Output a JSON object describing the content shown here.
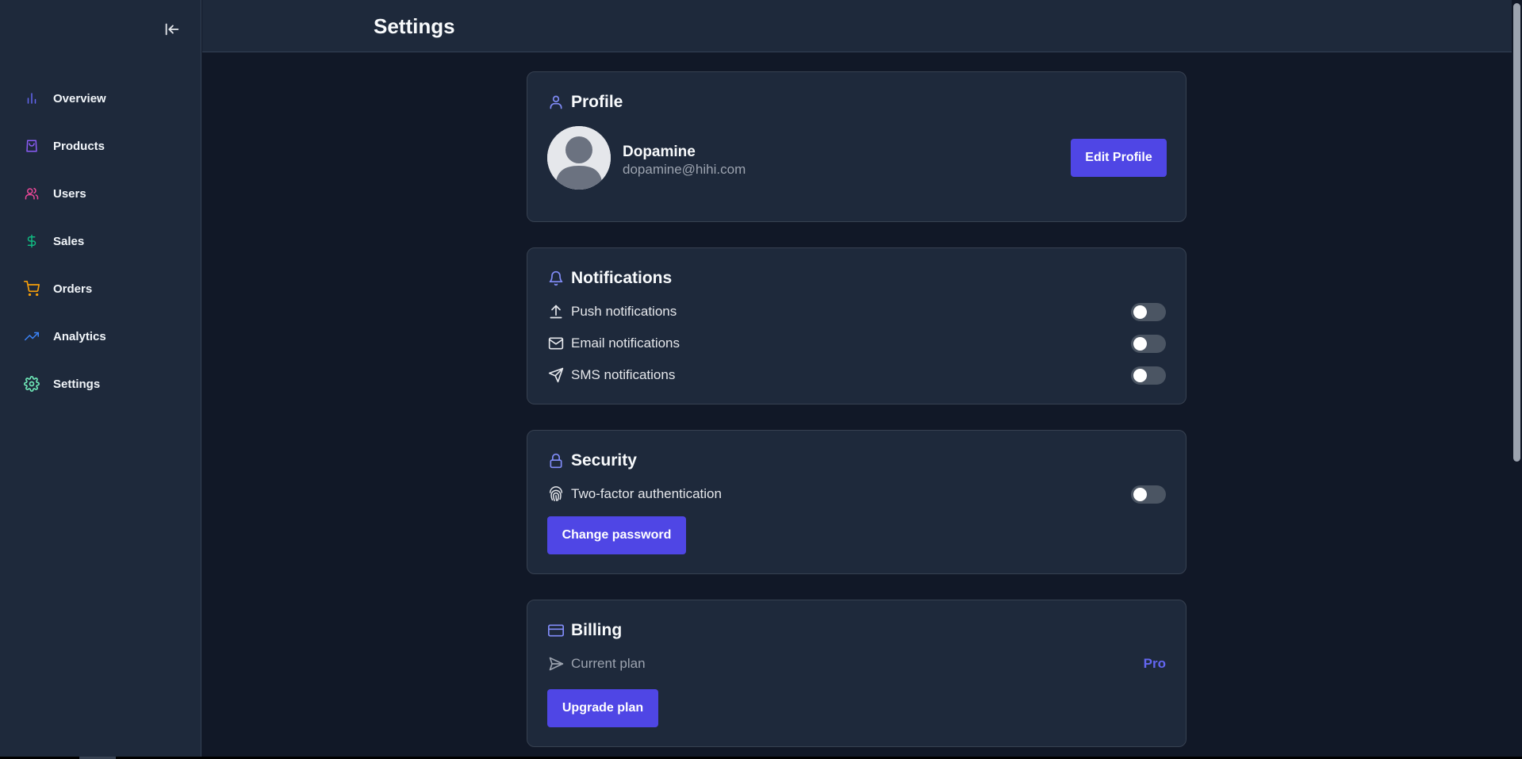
{
  "header": {
    "title": "Settings"
  },
  "sidebar": {
    "items": [
      {
        "label": "Overview",
        "icon": "bar-chart-icon",
        "color": "#6366f1"
      },
      {
        "label": "Products",
        "icon": "shopping-bag-icon",
        "color": "#8b5cf6"
      },
      {
        "label": "Users",
        "icon": "users-icon",
        "color": "#ec4899"
      },
      {
        "label": "Sales",
        "icon": "dollar-icon",
        "color": "#10b981"
      },
      {
        "label": "Orders",
        "icon": "shopping-cart-icon",
        "color": "#f59e0b"
      },
      {
        "label": "Analytics",
        "icon": "trending-up-icon",
        "color": "#3b82f6"
      },
      {
        "label": "Settings",
        "icon": "settings-icon",
        "color": "#6ee7b7"
      }
    ]
  },
  "profile": {
    "title": "Profile",
    "name": "Dopamine",
    "email": "dopamine@hihi.com",
    "edit_label": "Edit Profile"
  },
  "notifications": {
    "title": "Notifications",
    "items": [
      {
        "label": "Push notifications",
        "enabled": false
      },
      {
        "label": "Email notifications",
        "enabled": false
      },
      {
        "label": "SMS notifications",
        "enabled": false
      }
    ]
  },
  "security": {
    "title": "Security",
    "two_factor_label": "Two-factor authentication",
    "two_factor_enabled": false,
    "change_password_label": "Change password"
  },
  "billing": {
    "title": "Billing",
    "current_plan_label": "Current plan",
    "current_plan_value": "Pro",
    "upgrade_label": "Upgrade plan"
  },
  "colors": {
    "accent": "#4f46e5",
    "accent_text": "#6366f1",
    "background": "#111827",
    "surface": "#1e293b"
  }
}
